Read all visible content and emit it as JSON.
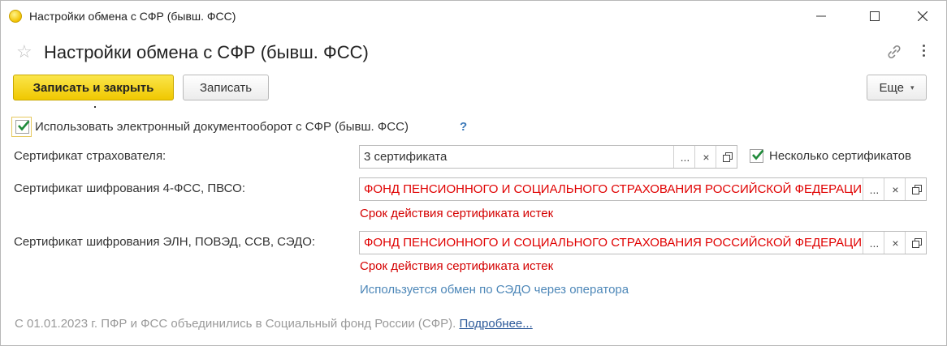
{
  "window": {
    "title": "Настройки обмена с СФР (бывш. ФСС)"
  },
  "form": {
    "title": "Настройки обмена с СФР (бывш. ФСС)"
  },
  "toolbar": {
    "save_close_label": "Записать и закрыть",
    "save_label": "Записать",
    "more_label": "Еще"
  },
  "edo": {
    "label": "Использовать электронный документооборот с СФР (бывш. ФСС)",
    "checked": true,
    "help": "?"
  },
  "fields": {
    "insurer_cert": {
      "label": "Сертификат страхователя:",
      "value": "3 сертификата",
      "multiple_label": "Несколько сертификатов",
      "multiple_checked": true
    },
    "enc_cert_4fss": {
      "label": "Сертификат шифрования 4-ФСС, ПВСО:",
      "value": "ФОНД ПЕНСИОННОГО И СОЦИАЛЬНОГО СТРАХОВАНИЯ РОССИЙСКОЙ ФЕДЕРАЦИИ",
      "error": "Срок действия сертификата истек"
    },
    "enc_cert_eln": {
      "label": "Сертификат шифрования ЭЛН, ПОВЭД, ССВ, СЭДО:",
      "value": "ФОНД ПЕНСИОННОГО И СОЦИАЛЬНОГО СТРАХОВАНИЯ РОССИЙСКОЙ ФЕДЕРАЦИИ",
      "error": "Срок действия сертификата истек",
      "info": "Используется обмен по СЭДО через оператора"
    }
  },
  "field_buttons": {
    "select": "...",
    "clear": "×"
  },
  "footer": {
    "text": "С 01.01.2023 г. ПФР и ФСС объединились в Социальный фонд России (СФР).",
    "link": "Подробнее..."
  },
  "colors": {
    "primary_button": "#f5d21a",
    "error_text": "#d40000",
    "info_text": "#4d87b8",
    "checkmark": "#1f8a3a",
    "link": "#2d5a9a"
  },
  "icons": [
    "app-icon",
    "minimize-icon",
    "maximize-icon",
    "close-icon",
    "star-icon",
    "link-icon",
    "more-vertical-icon",
    "checkmark-icon",
    "open-icon",
    "clear-icon"
  ]
}
